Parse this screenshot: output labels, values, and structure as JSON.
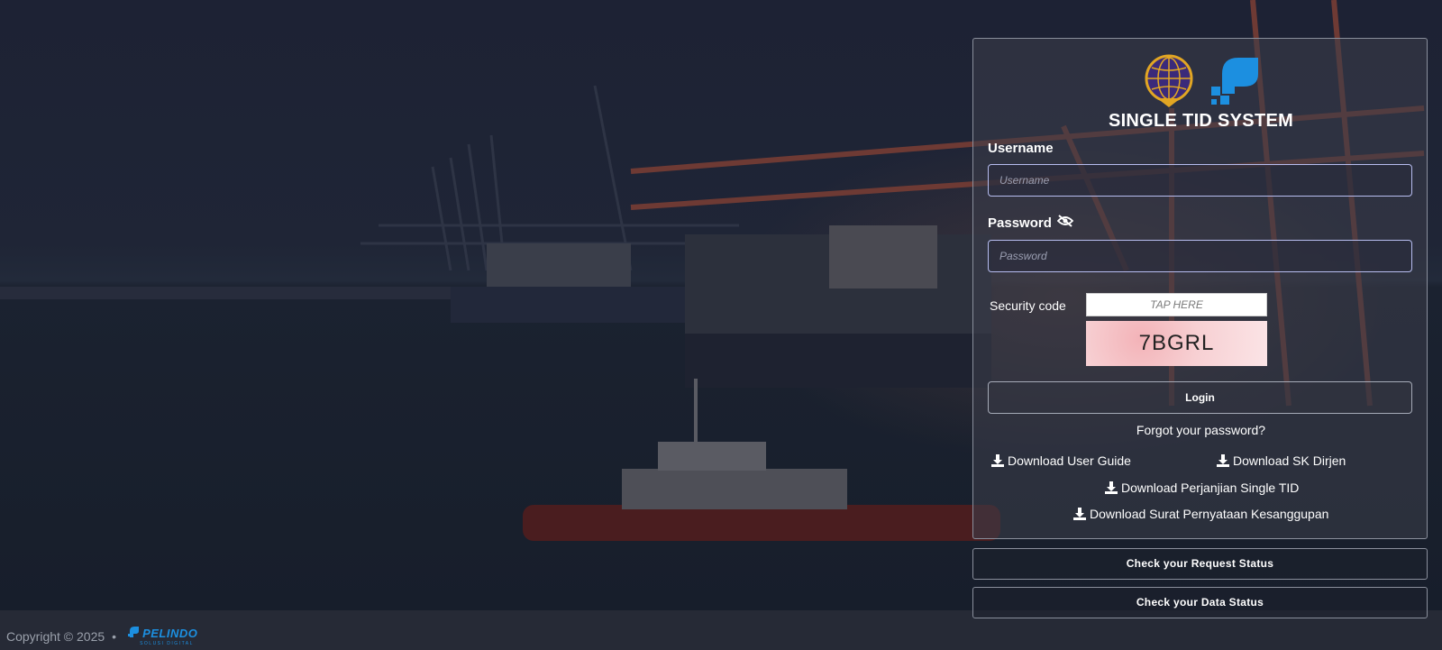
{
  "app": {
    "title": "SINGLE TID SYSTEM"
  },
  "login": {
    "username_label": "Username",
    "username_placeholder": "Username",
    "username_value": "",
    "password_label": "Password",
    "password_placeholder": "Password",
    "password_value": "",
    "security_label": "Security code",
    "security_placeholder": "TAP HERE",
    "captcha_text": "7BGRL",
    "login_label": "Login",
    "forgot_label": "Forgot your password?"
  },
  "downloads": {
    "user_guide": "Download User Guide",
    "sk_dirjen": "Download SK Dirjen",
    "perjanjian": "Download Perjanjian Single TID",
    "surat": "Download Surat Pernyataan Kesanggupan"
  },
  "status_buttons": {
    "request": "Check your Request Status",
    "data": "Check your Data Status"
  },
  "footer": {
    "copyright": "Copyright © 2025",
    "separator": "•",
    "brand": "PELINDO",
    "brand_tagline": "SOLUSI DIGITAL"
  },
  "icons": {
    "download": "download-icon",
    "password_toggle": "eye-slash-icon",
    "ministry_logo": "globe-emblem-icon",
    "pelindo_logo": "pelindo-mark-icon"
  },
  "colors": {
    "accent_blue": "#1c8fe0",
    "panel_border": "#8a8f9c",
    "input_border": "#b7bdf0",
    "emblem_purple": "#3b2a7a",
    "emblem_gold": "#e2a623"
  }
}
